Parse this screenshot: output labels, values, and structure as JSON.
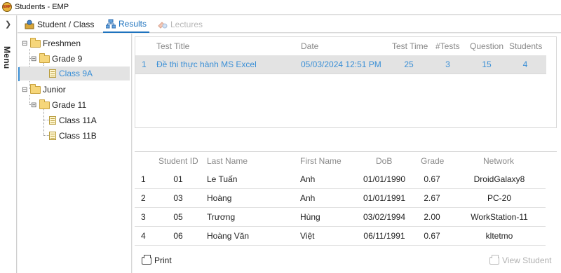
{
  "window": {
    "title": "Students - EMP",
    "icon": "emp-app-icon"
  },
  "menu": {
    "label": "Menu",
    "icon": "chevron-right-icon"
  },
  "tabs": [
    {
      "label": "Student / Class",
      "icon": "student-class-icon",
      "state": "normal"
    },
    {
      "label": "Results",
      "icon": "results-network-icon",
      "state": "active"
    },
    {
      "label": "Lectures",
      "icon": "lectures-icon",
      "state": "disabled"
    }
  ],
  "tree": {
    "freshmen": "Freshmen",
    "grade9": "Grade 9",
    "class9a": "Class 9A",
    "junior": "Junior",
    "grade11": "Grade 11",
    "class11a": "Class 11A",
    "class11b": "Class 11B",
    "selected": "Class 9A"
  },
  "tests": {
    "columns": [
      "Test Title",
      "Date",
      "Test Time",
      "#Tests",
      "Question",
      "Students"
    ],
    "rows": [
      {
        "index": "1",
        "title": "Đề thi thực hành MS Excel",
        "date": "05/03/2024 12:51 PM",
        "test_time": "25",
        "tests": "3",
        "question": "15",
        "students": "4"
      }
    ]
  },
  "students": {
    "columns": [
      "Student ID",
      "Last Name",
      "First Name",
      "DoB",
      "Grade",
      "Network"
    ],
    "rows": [
      {
        "index": "1",
        "id": "01",
        "last": "Le Tuấn",
        "first": "Anh",
        "dob": "01/01/1990",
        "grade": "0.67",
        "network": "DroidGalaxy8"
      },
      {
        "index": "2",
        "id": "03",
        "last": "Hoàng",
        "first": "Anh",
        "dob": "01/01/1991",
        "grade": "2.67",
        "network": "PC-20"
      },
      {
        "index": "3",
        "id": "05",
        "last": "Trương",
        "first": "Hùng",
        "dob": "03/02/1994",
        "grade": "2.00",
        "network": "WorkStation-11"
      },
      {
        "index": "4",
        "id": "06",
        "last": "Hoàng Văn",
        "first": "Việt",
        "dob": "06/11/1991",
        "grade": "0.67",
        "network": "kltetmo"
      }
    ]
  },
  "footer": {
    "print_label": "Print",
    "view_student_label": "View Student"
  },
  "colors": {
    "accent": "#3a8fd6",
    "selected_row": "#e3e3e3",
    "folder": "#f6d67a"
  }
}
